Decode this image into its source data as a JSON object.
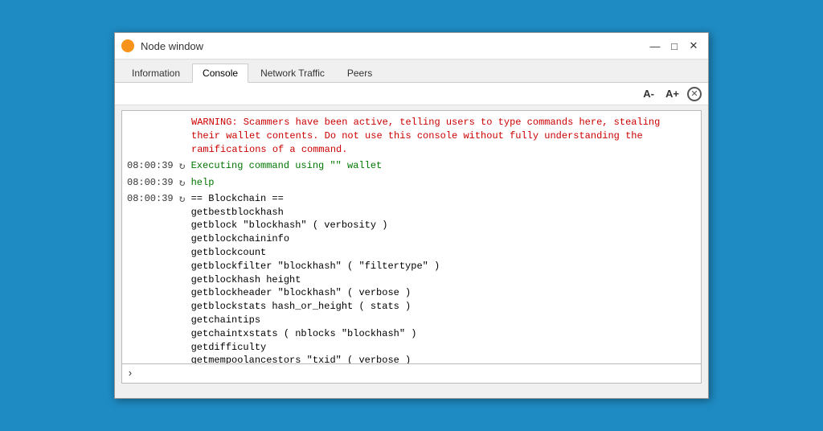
{
  "window": {
    "title": "Node window",
    "icon": "bitcoin-icon"
  },
  "title_controls": {
    "minimize": "—",
    "maximize": "□",
    "close": "✕"
  },
  "tabs": [
    {
      "label": "Information",
      "active": false
    },
    {
      "label": "Console",
      "active": true
    },
    {
      "label": "Network Traffic",
      "active": false
    },
    {
      "label": "Peers",
      "active": false
    }
  ],
  "toolbar": {
    "font_decrease": "A-",
    "font_increase": "A+",
    "close_label": "⊗"
  },
  "console": {
    "warning": "WARNING: Scammers have been active, telling users to type commands here, stealing\ntheir wallet contents. Do not use this console without fully understanding the\nramifications of a command.",
    "lines": [
      {
        "time": "08:00:39",
        "icon": "↻",
        "text": "Executing command using \"\" wallet"
      },
      {
        "time": "08:00:39",
        "icon": "↻",
        "text": "help"
      },
      {
        "time": "08:00:39",
        "icon": "↻",
        "text": "== Blockchain ==\ngetbestblockhash\ngetblock \"blockhash\" ( verbosity )\ngetblockchaininfo\ngetblockcount\ngetblockfilter \"blockhash\" ( \"filtertype\" )\ngetblockhash height\ngetblockheader \"blockhash\" ( verbose )\ngetblockstats hash_or_height ( stats )\ngetchaintips\ngetchaintxstats ( nblocks \"blockhash\" )\ngetdifficulty\ngetmempoolancestors \"txid\" ( verbose )\ngetmempooldescendants \"txid\" ( verbose )\ngetmempoolentry \"txid\"\ngetmempoolinfo"
      }
    ],
    "prompt": "›",
    "input_placeholder": ""
  }
}
